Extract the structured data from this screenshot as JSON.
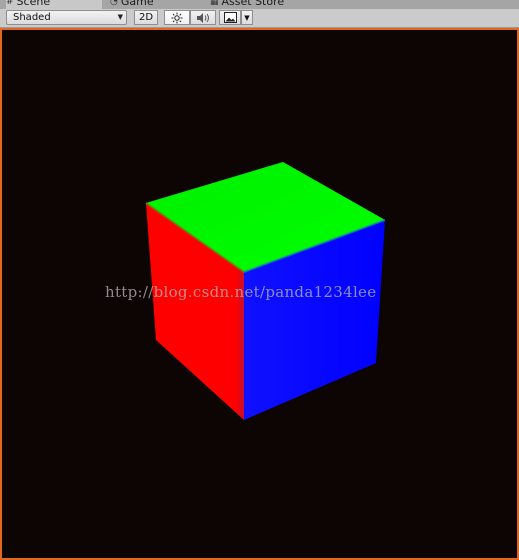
{
  "tabs": [
    {
      "label": "Scene",
      "icon": "hash-icon"
    },
    {
      "label": "Game",
      "icon": "pacman-icon"
    },
    {
      "label": "Asset Store",
      "icon": "store-icon"
    }
  ],
  "toolbar": {
    "shading_mode": "Shaded",
    "mode_2d_label": "2D"
  },
  "viewport": {
    "watermark": "http://blog.csdn.net/panda1234lee",
    "cube_faces": {
      "top": "#00ff00",
      "left": "#ff0000",
      "right": "#0000ff"
    }
  },
  "colors": {
    "viewport_background": "#0d0404",
    "viewport_border": "#e2671f"
  }
}
